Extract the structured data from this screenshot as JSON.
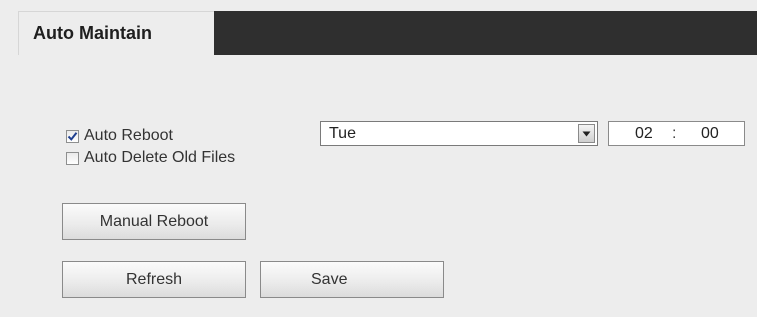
{
  "panel": {
    "title": "Auto Maintain"
  },
  "auto_reboot": {
    "label": "Auto Reboot",
    "checked": true,
    "day_selected": "Tue",
    "hour": "02",
    "separator": ":",
    "minute": "00"
  },
  "auto_delete": {
    "label": "Auto Delete Old Files",
    "checked": false
  },
  "buttons": {
    "manual_reboot": "Manual Reboot",
    "refresh": "Refresh",
    "save": "Save"
  },
  "colors": {
    "header_dark": "#2f2f2f",
    "panel_bg": "#ededed",
    "check_blue": "#1f3f8f"
  },
  "icons": {
    "checkbox_checked": "check-mark-icon",
    "select_arrow": "chevron-down-icon"
  }
}
